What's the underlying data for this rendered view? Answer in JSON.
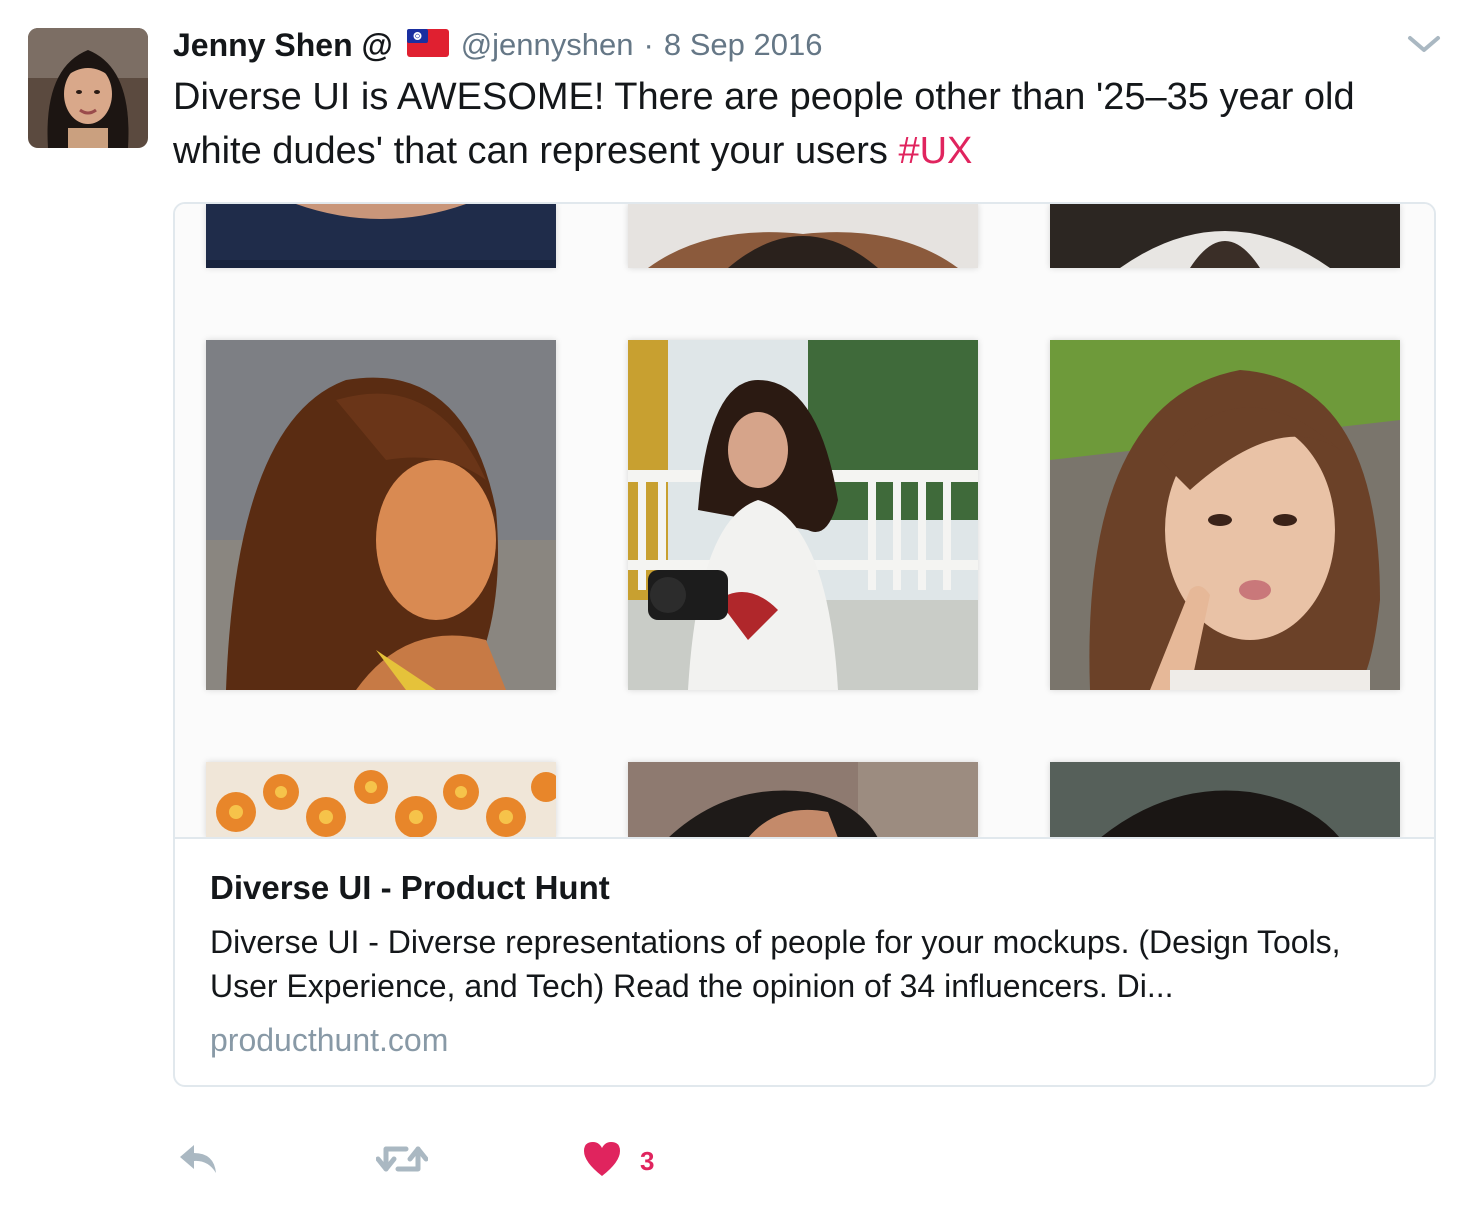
{
  "tweet": {
    "author_name": "Jenny Shen @",
    "handle": "@jennyshen",
    "separator": "·",
    "date": "8 Sep 2016",
    "text_main": "Diverse UI is AWESOME! There are people other than '25–35 year old white dudes' that can represent your users ",
    "hashtag": "#UX"
  },
  "card": {
    "title": "Diverse UI - Product Hunt",
    "description": "Diverse UI - Diverse representations of people for your mockups. (Design Tools, User Experience, and Tech) Read the opinion of 34 influencers. Di...",
    "domain": "producthunt.com"
  },
  "actions": {
    "reply_icon": "reply-icon",
    "retweet_icon": "retweet-icon",
    "like_icon": "heart-icon",
    "like_count": "3"
  },
  "colors": {
    "accent": "#e0245e",
    "muted": "#657786",
    "border": "#e1e8ed"
  }
}
